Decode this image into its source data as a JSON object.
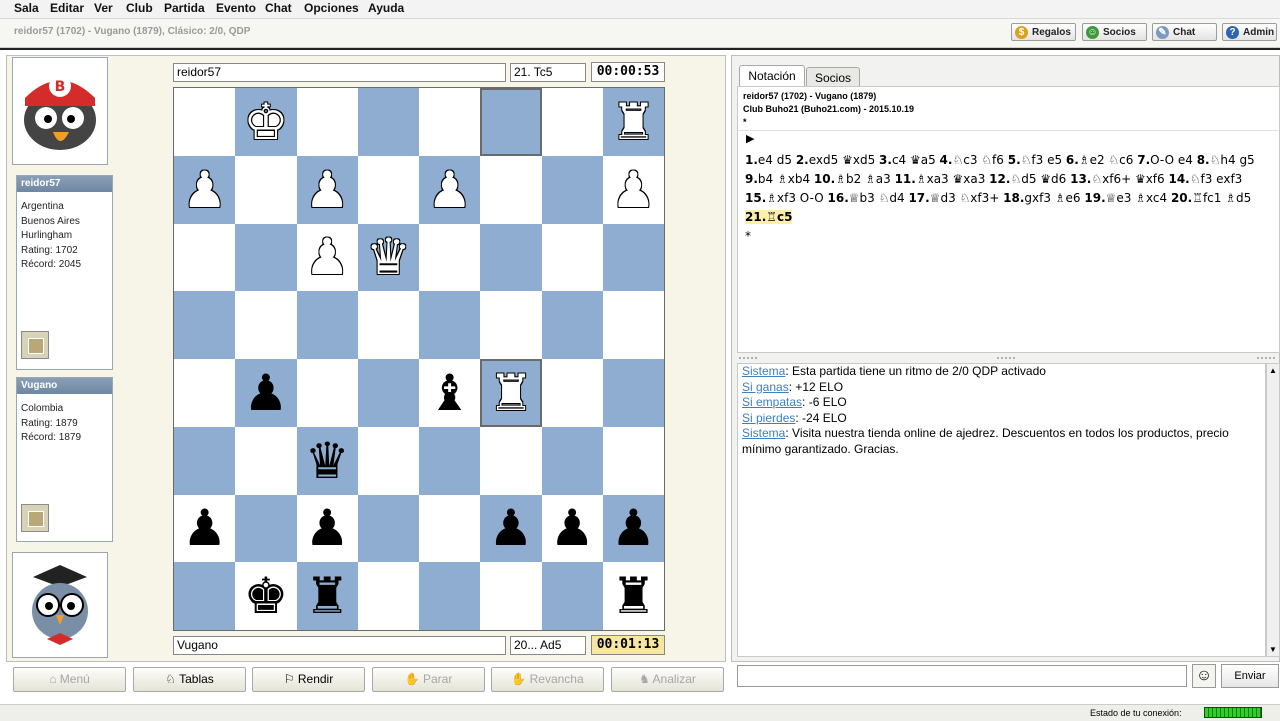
{
  "menu": [
    "Sala",
    "Editar",
    "Ver",
    "Club",
    "Partida",
    "Evento",
    "Chat",
    "Opciones",
    "Ayuda"
  ],
  "game_title": "reidor57 (1702) - Vugano (1879), Clásico: 2/0, QDP",
  "toolbar": {
    "regalos": "Regalos",
    "socios": "Socios",
    "chat": "Chat",
    "admin": "Admin"
  },
  "players": {
    "top": {
      "name": "reidor57",
      "info": [
        "Argentina",
        "Buenos Aires",
        "Hurlingham",
        "Rating: 1702",
        "Récord: 2045"
      ]
    },
    "bottom": {
      "name": "Vugano",
      "info": [
        "Colombia",
        "Rating: 1879",
        "Récord: 1879"
      ]
    }
  },
  "board_header": {
    "player": "reidor57",
    "last_move": "21. Tc5",
    "clock": "00:00:53"
  },
  "board_footer": {
    "player": "Vugano",
    "last_move": "20... Ad5",
    "clock": "00:01:13"
  },
  "board": [
    [
      "",
      "wK",
      "",
      "",
      "",
      "*",
      "",
      "wR"
    ],
    [
      "wP",
      "",
      "wP",
      "",
      "wP",
      "",
      "",
      "wP"
    ],
    [
      "",
      "",
      "wP",
      "wQ",
      "",
      "",
      "",
      ""
    ],
    [
      "",
      "",
      "",
      "",
      "",
      "",
      "",
      ""
    ],
    [
      "",
      "bP",
      "",
      "",
      "bB",
      "*wR",
      "",
      ""
    ],
    [
      "",
      "",
      "bQ",
      "",
      "",
      "",
      "",
      ""
    ],
    [
      "bP",
      "",
      "bP",
      "",
      "",
      "bP",
      "bP",
      "bP"
    ],
    [
      "",
      "bK",
      "bR",
      "",
      "",
      "",
      "",
      "bR"
    ]
  ],
  "buttons": {
    "menu": "Menú",
    "tablas": "Tablas",
    "rendir": "Rendir",
    "parar": "Parar",
    "revancha": "Revancha",
    "analizar": "Analizar"
  },
  "tabs": {
    "notacion": "Notación",
    "socios": "Socios"
  },
  "notation_header": [
    "reidor57 (1702) - Vugano (1879)",
    "Club Buho21 (Buho21.com) - 2015.10.19",
    "*"
  ],
  "moves": [
    [
      "1.",
      "e4",
      "d5"
    ],
    [
      "2.",
      "exd5",
      "♛xd5"
    ],
    [
      "3.",
      "c4",
      "♛a5"
    ],
    [
      "4.",
      "♘c3",
      "♘f6"
    ],
    [
      "5.",
      "♘f3",
      "e5"
    ],
    [
      "6.",
      "♗e2",
      "♘c6"
    ],
    [
      "7.",
      "O-O",
      "e4"
    ],
    [
      "8.",
      "♘h4",
      "g5"
    ],
    [
      "9.",
      "b4",
      "♗xb4"
    ],
    [
      "10.",
      "♗b2",
      "♗a3"
    ],
    [
      "11.",
      "♗xa3",
      "♛xa3"
    ],
    [
      "12.",
      "♘d5",
      "♛d6"
    ],
    [
      "13.",
      "♘xf6+",
      "♛xf6"
    ],
    [
      "14.",
      "♘f3",
      "exf3"
    ],
    [
      "15.",
      "♗xf3",
      "O-O"
    ],
    [
      "16.",
      "♕b3",
      "♘d4"
    ],
    [
      "17.",
      "♕d3",
      "♘xf3+"
    ],
    [
      "18.",
      "gxf3",
      "♗e6"
    ],
    [
      "19.",
      "♕e3",
      "♗xc4"
    ],
    [
      "20.",
      "♖fc1",
      "♗d5"
    ]
  ],
  "current_move": "21.♖c5",
  "result": "*",
  "chat": [
    {
      "who": "Sistema",
      "text": ": Esta partida tiene un ritmo de 2/0 QDP activado"
    },
    {
      "who": "Si ganas",
      "text": ": +12 ELO"
    },
    {
      "who": "Si empatas",
      "text": ": -6 ELO"
    },
    {
      "who": "Si pierdes",
      "text": ": -24 ELO"
    },
    {
      "who": "Sistema",
      "text": ": Visita nuestra tienda online de ajedrez. Descuentos en todos los productos, precio mínimo garantizado. Gracias."
    }
  ],
  "send_label": "Enviar",
  "status_label": "Estado de tu conexión:",
  "colors": {
    "dark_square": "#8fadd0",
    "light_square": "#ffffff",
    "clock_active": "#f7e6a0",
    "chat_link": "#3e7ec2"
  }
}
